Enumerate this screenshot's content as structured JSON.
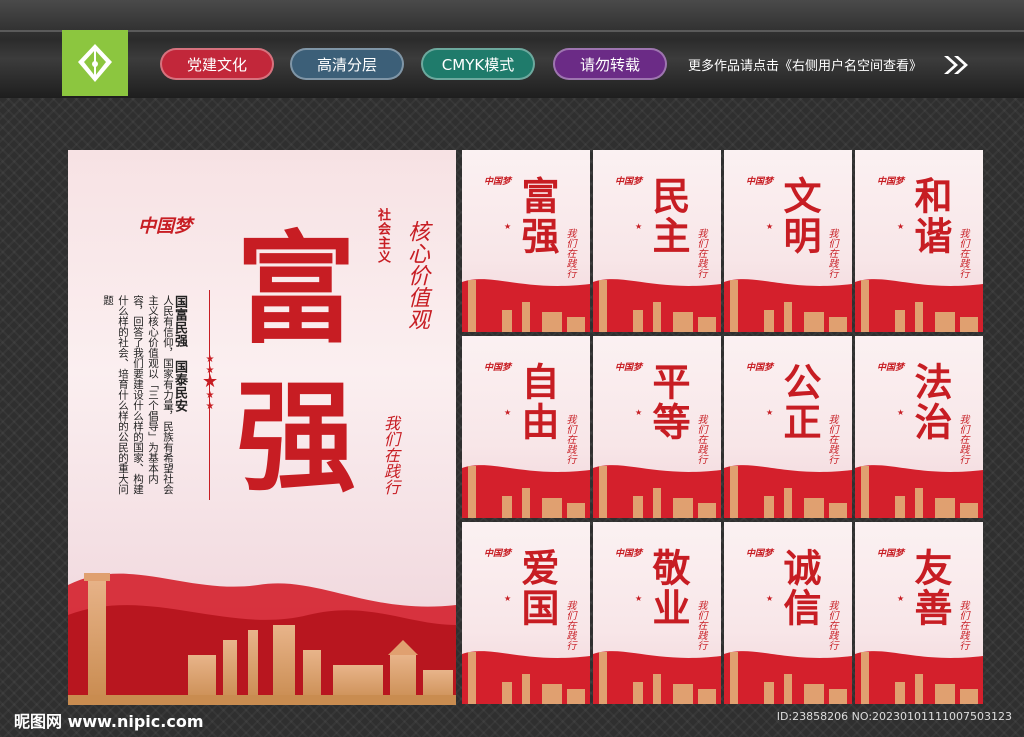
{
  "header": {
    "tags": [
      "党建文化",
      "高清分层",
      "CMYK模式",
      "请勿转载"
    ],
    "more_text": "更多作品请点击《右侧用户名空间查看》"
  },
  "main_poster": {
    "title_char_1": "富",
    "title_char_2": "强",
    "dream_logo": "中国梦",
    "core_values": "社会主义",
    "hexin": "核心价值观",
    "slogan_1": "国富民强",
    "slogan_2": "国泰民安",
    "body_text": "人民有信仰，国家有力量，民族有希望社会主义核心价值观以「三个倡导」为基本内容，回答了我们要建设什么样的国家、构建什么样的社会、培育什么样的公民的重大问题",
    "signature": "我们在践行"
  },
  "small_posters": [
    {
      "title": "富强"
    },
    {
      "title": "民主"
    },
    {
      "title": "文明"
    },
    {
      "title": "和谐"
    },
    {
      "title": "自由"
    },
    {
      "title": "平等"
    },
    {
      "title": "公正"
    },
    {
      "title": "法治"
    },
    {
      "title": "爱国"
    },
    {
      "title": "敬业"
    },
    {
      "title": "诚信"
    },
    {
      "title": "友善"
    }
  ],
  "footer": {
    "site": "昵图网 www.nipic.com",
    "id_text": "ID:23858206 NO:20230101111007503123"
  },
  "colors": {
    "brand_red": "#c71d23",
    "logo_green": "#8cc63f"
  }
}
